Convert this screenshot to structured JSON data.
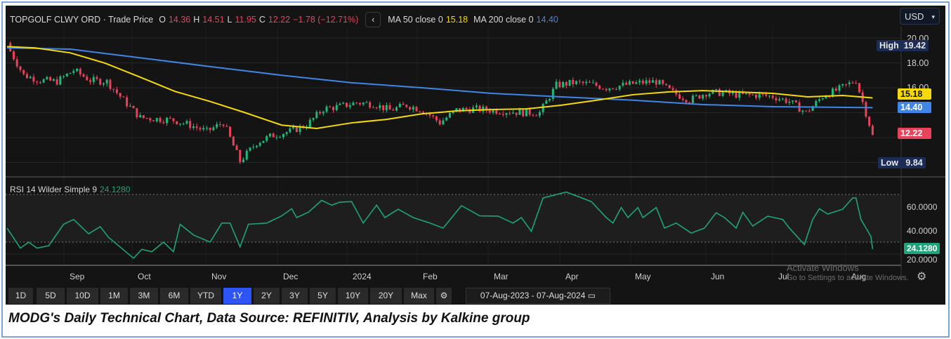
{
  "header": {
    "instrument": "TOPGOLF CLWY ORD · Trade Price",
    "o_label": "O",
    "o": "14.36",
    "h_label": "H",
    "h": "14.51",
    "l_label": "L",
    "l": "11.95",
    "c_label": "C",
    "c": "12.22",
    "change": "−1.78 (−12.71%)",
    "back_icon": "chevron-left-icon",
    "ma50_label": "MA 50 close 0",
    "ma50": "15.18",
    "ma200_label": "MA 200 close 0",
    "ma200": "14.40"
  },
  "currency": "USD",
  "price_axis": {
    "ticks": [
      "20.00",
      "18.00",
      "16.00"
    ],
    "high_label": "High",
    "high": "19.42",
    "low_label": "Low",
    "low": "9.84",
    "last": "12.22",
    "ma50_tag": "15.18",
    "ma200_tag": "14.40"
  },
  "rsi": {
    "label": "RSI 14 Wilder Simple 9",
    "value": "24.1280",
    "ticks": [
      "60.0000",
      "40.0000",
      "20.0000"
    ]
  },
  "months": [
    "Sep",
    "Oct",
    "Nov",
    "Dec",
    "2024",
    "Feb",
    "Mar",
    "Apr",
    "May",
    "Jun",
    "Jul",
    "Aug"
  ],
  "ranges": [
    "1D",
    "5D",
    "10D",
    "1M",
    "3M",
    "6M",
    "YTD",
    "1Y",
    "2Y",
    "3Y",
    "5Y",
    "10Y",
    "20Y",
    "Max"
  ],
  "selected_range": "1Y",
  "date_range": {
    "from": "07-Aug-2023",
    "sep": "-",
    "to": "07-Aug-2024"
  },
  "watermark": {
    "line1": "Activate Windows",
    "line2": "Go to Settings to activate Windows."
  },
  "caption": "MODG's Daily Technical Chart, Data Source: REFINITIV, Analysis by Kalkine group",
  "colors": {
    "up": "#22b87a",
    "down": "#e8435a",
    "ma50": "#f5d90a",
    "ma200": "#3f86e8",
    "rsi": "#1fa37a"
  },
  "chart_data": {
    "type": "candlestick",
    "x_unit": "weeks since 07-Aug-2023",
    "ylim": [
      9,
      21
    ],
    "weekly_close": [
      19.4,
      17.0,
      16.6,
      16.5,
      17.4,
      16.6,
      16.5,
      15.0,
      13.6,
      13.5,
      13.4,
      13.0,
      12.5,
      13.2,
      10.1,
      11.6,
      12.2,
      12.5,
      13.0,
      14.3,
      14.5,
      14.8,
      14.7,
      14.2,
      14.6,
      14.2,
      13.2,
      14.2,
      14.3,
      14.2,
      14.1,
      14.0,
      14.0,
      16.2,
      16.4,
      16.3,
      16.0,
      16.2,
      16.4,
      16.5,
      15.6,
      15.0,
      15.6,
      15.6,
      15.4,
      15.4,
      15.3,
      14.9,
      14.0,
      15.3,
      15.9,
      16.6,
      12.22
    ],
    "ma200": [
      [
        0,
        19.2
      ],
      [
        3.8,
        19.1
      ],
      [
        8,
        18.4
      ],
      [
        12.2,
        17.7
      ],
      [
        16.5,
        17.0
      ],
      [
        20.7,
        16.4
      ],
      [
        24.9,
        16.0
      ],
      [
        29.1,
        15.55
      ],
      [
        33.3,
        15.27
      ],
      [
        37.6,
        15.0
      ],
      [
        41.8,
        14.65
      ],
      [
        46,
        14.48
      ],
      [
        52,
        14.4
      ]
    ],
    "ma50": [
      [
        0,
        19.3
      ],
      [
        1.7,
        19.2
      ],
      [
        3.8,
        18.8
      ],
      [
        5.9,
        17.97
      ],
      [
        8,
        16.85
      ],
      [
        10.1,
        15.7
      ],
      [
        12.2,
        14.9
      ],
      [
        14.3,
        14.0
      ],
      [
        16.5,
        13.0
      ],
      [
        18.6,
        12.73
      ],
      [
        20.7,
        13.18
      ],
      [
        22.8,
        13.46
      ],
      [
        24.9,
        13.9
      ],
      [
        27,
        14.14
      ],
      [
        29.1,
        14.25
      ],
      [
        31.2,
        14.3
      ],
      [
        33.3,
        14.6
      ],
      [
        35.4,
        14.99
      ],
      [
        37.6,
        15.44
      ],
      [
        39.7,
        15.66
      ],
      [
        41.8,
        15.77
      ],
      [
        43.9,
        15.66
      ],
      [
        46,
        15.55
      ],
      [
        48.1,
        15.27
      ],
      [
        50.2,
        15.38
      ],
      [
        52,
        15.18
      ]
    ],
    "rsi": [
      [
        0,
        41.8
      ],
      [
        0.8,
        25
      ],
      [
        1.3,
        30
      ],
      [
        1.8,
        25
      ],
      [
        2.5,
        27
      ],
      [
        3.4,
        45
      ],
      [
        4,
        49
      ],
      [
        4.9,
        37
      ],
      [
        5.6,
        43
      ],
      [
        6.1,
        34
      ],
      [
        7.6,
        16.5
      ],
      [
        8.1,
        24
      ],
      [
        8.7,
        22
      ],
      [
        9.4,
        30
      ],
      [
        10,
        22
      ],
      [
        10.4,
        45
      ],
      [
        11.2,
        36
      ],
      [
        12.2,
        30
      ],
      [
        12.9,
        46
      ],
      [
        13.4,
        46
      ],
      [
        14,
        26
      ],
      [
        14.5,
        45
      ],
      [
        15.6,
        46
      ],
      [
        16.5,
        52
      ],
      [
        17.1,
        58
      ],
      [
        17.4,
        50.6
      ],
      [
        18.1,
        55
      ],
      [
        18.9,
        65
      ],
      [
        19.5,
        61
      ],
      [
        20,
        63.5
      ],
      [
        20.7,
        64
      ],
      [
        21.4,
        46
      ],
      [
        22.2,
        61
      ],
      [
        22.7,
        50.6
      ],
      [
        23.5,
        57.6
      ],
      [
        24.4,
        50.6
      ],
      [
        25.4,
        46
      ],
      [
        26.2,
        41.8
      ],
      [
        27.3,
        60.6
      ],
      [
        28.4,
        52
      ],
      [
        29.5,
        51.8
      ],
      [
        30.4,
        46
      ],
      [
        30.9,
        50.6
      ],
      [
        31.5,
        39
      ],
      [
        32.2,
        67
      ],
      [
        33.6,
        72
      ],
      [
        35.1,
        64
      ],
      [
        36,
        50.6
      ],
      [
        36.4,
        46
      ],
      [
        36.9,
        59
      ],
      [
        37.3,
        50.6
      ],
      [
        37.9,
        59
      ],
      [
        38.2,
        50.6
      ],
      [
        39,
        59
      ],
      [
        39.5,
        41.8
      ],
      [
        40.2,
        46
      ],
      [
        41.1,
        37.6
      ],
      [
        41.9,
        41.8
      ],
      [
        42.6,
        54.7
      ],
      [
        43.1,
        50.6
      ],
      [
        43.8,
        41.8
      ],
      [
        44.2,
        55
      ],
      [
        44.8,
        43.5
      ],
      [
        45.7,
        51.8
      ],
      [
        46.6,
        49
      ],
      [
        47,
        41.8
      ],
      [
        47.9,
        28
      ],
      [
        48.4,
        49
      ],
      [
        48.8,
        58
      ],
      [
        49.3,
        53.5
      ],
      [
        50.2,
        57.6
      ],
      [
        50.8,
        67
      ],
      [
        51,
        67
      ],
      [
        51.3,
        49
      ],
      [
        51.9,
        34.7
      ],
      [
        52,
        24.128
      ]
    ],
    "rsi_ylim": [
      15,
      78
    ],
    "rsi_levels": [
      70,
      30
    ]
  }
}
